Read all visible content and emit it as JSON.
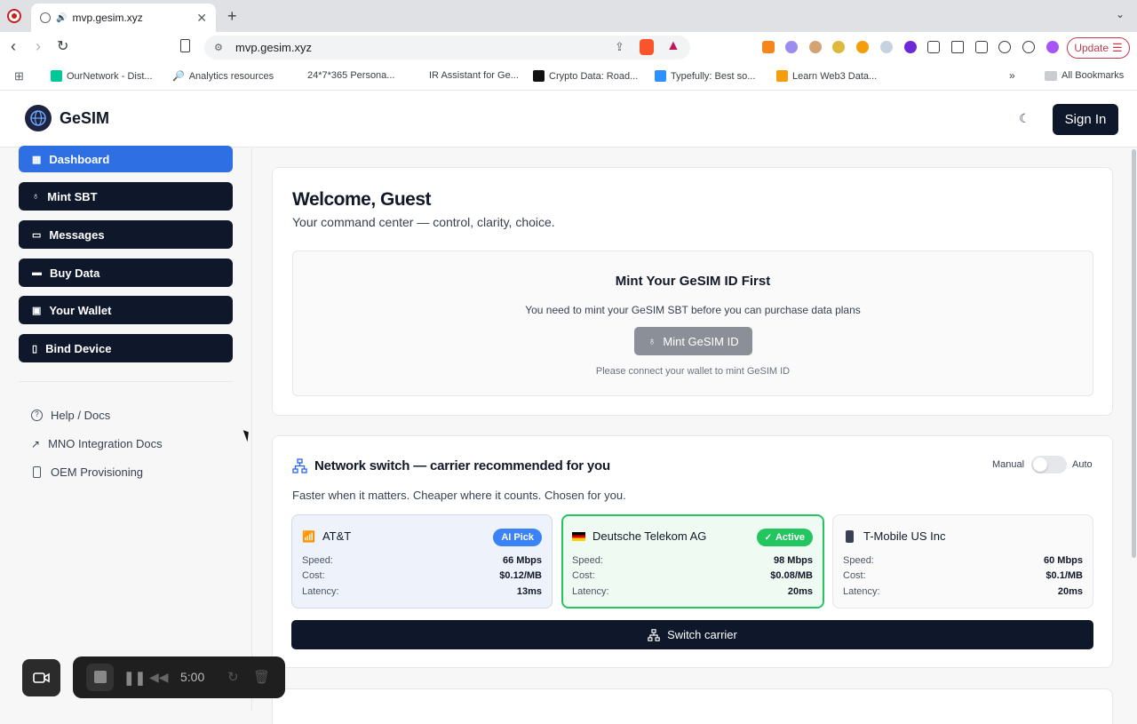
{
  "browser": {
    "tab_title": "mvp.gesim.xyz",
    "url": "mvp.gesim.xyz",
    "update_label": "Update",
    "bookmarks": [
      "OurNetwork - Dist...",
      "Analytics resources",
      "24*7*365 Persona...",
      "IR Assistant for Ge...",
      "Crypto Data: Road...",
      "Typefully: Best so...",
      "Learn Web3 Data...",
      "All Bookmarks"
    ]
  },
  "app": {
    "brand": "GeSIM",
    "sign_in": "Sign In"
  },
  "sidebar": {
    "items": [
      "Dashboard",
      "Mint SBT",
      "Messages",
      "Buy Data",
      "Your Wallet",
      "Bind Device"
    ],
    "links": [
      "Help / Docs",
      "MNO Integration Docs",
      "OEM Provisioning"
    ]
  },
  "welcome": {
    "title": "Welcome, Guest",
    "subtitle": "Your command center — control, clarity, choice.",
    "mint_title": "Mint Your GeSIM ID First",
    "mint_desc": "You need to mint your GeSIM SBT before you can purchase data plans",
    "mint_button": "Mint GeSIM ID",
    "mint_note": "Please connect your wallet to mint GeSIM ID"
  },
  "network": {
    "title": "Network switch — carrier recommended for you",
    "subtitle": "Faster when it matters. Cheaper where it counts. Chosen for you.",
    "manual": "Manual",
    "auto": "Auto",
    "switch_button": "Switch carrier",
    "labels": {
      "speed": "Speed:",
      "cost": "Cost:",
      "latency": "Latency:"
    },
    "carriers": [
      {
        "name": "AT&T",
        "badge": "AI Pick",
        "speed": "66 Mbps",
        "cost": "$0.12/MB",
        "latency": "13ms"
      },
      {
        "name": "Deutsche Telekom AG",
        "badge": "Active",
        "speed": "98 Mbps",
        "cost": "$0.08/MB",
        "latency": "20ms"
      },
      {
        "name": "T-Mobile US Inc",
        "badge": "",
        "speed": "60 Mbps",
        "cost": "$0.1/MB",
        "latency": "20ms"
      }
    ]
  },
  "recorder": {
    "time": "5:00"
  },
  "colors": {
    "primary_dark": "#0f172a",
    "active_blue": "#2f6fe4",
    "active_green": "#22c55e"
  }
}
